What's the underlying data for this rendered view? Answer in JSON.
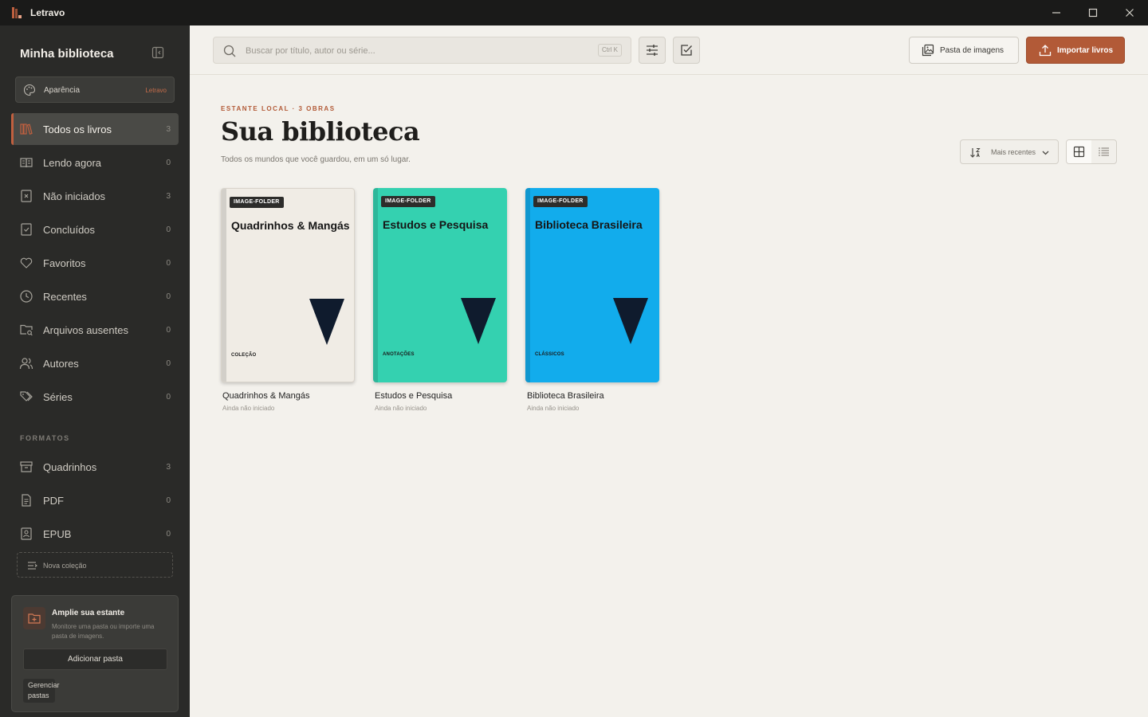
{
  "window": {
    "app_name": "Letravo"
  },
  "sidebar": {
    "title": "Minha biblioteca",
    "appearance": {
      "label": "Aparência",
      "theme": "Letravo"
    },
    "items": [
      {
        "label": "Todos os livros",
        "count": "3",
        "icon": "books-icon",
        "active": true
      },
      {
        "label": "Lendo agora",
        "count": "0",
        "icon": "book-open-icon"
      },
      {
        "label": "Não iniciados",
        "count": "3",
        "icon": "book-x-icon"
      },
      {
        "label": "Concluídos",
        "count": "0",
        "icon": "book-check-icon"
      },
      {
        "label": "Favoritos",
        "count": "0",
        "icon": "heart-icon"
      },
      {
        "label": "Recentes",
        "count": "0",
        "icon": "clock-icon"
      },
      {
        "label": "Arquivos ausentes",
        "count": "0",
        "icon": "folder-search-icon"
      },
      {
        "label": "Autores",
        "count": "0",
        "icon": "users-icon"
      },
      {
        "label": "Séries",
        "count": "0",
        "icon": "tags-icon"
      }
    ],
    "formats_heading": "FORMATOS",
    "formats": [
      {
        "label": "Quadrinhos",
        "count": "3",
        "icon": "archive-icon"
      },
      {
        "label": "PDF",
        "count": "0",
        "icon": "file-text-icon"
      },
      {
        "label": "EPUB",
        "count": "0",
        "icon": "book-image-icon"
      }
    ],
    "new_collection": "Nova coleção",
    "promo": {
      "title": "Amplie sua estante",
      "description": "Monitore uma pasta ou importe uma pasta de imagens.",
      "add_folder": "Adicionar pasta",
      "manage_folders": "Gerenciar pastas"
    }
  },
  "toolbar": {
    "search_placeholder": "Buscar por título, autor ou série...",
    "search_shortcut": "Ctrl K",
    "image_folder_label": "Pasta de imagens",
    "import_label": "Importar livros"
  },
  "main": {
    "eyebrow": "ESTANTE LOCAL · 3 OBRAS",
    "title": "Sua biblioteca",
    "subtitle": "Todos os mundos que você guardou, em um só lugar.",
    "sort_label": "Mais recentes"
  },
  "books": [
    {
      "badge": "IMAGE-FOLDER",
      "cover_title": "Quadrinhos & Mangás",
      "cover_tag": "COLEÇÃO",
      "title": "Quadrinhos & Mangás",
      "status": "Ainda não iniciado",
      "color": "#f0ece5"
    },
    {
      "badge": "IMAGE-FOLDER",
      "cover_title": "Estudos e Pesquisa",
      "cover_tag": "ANOTAÇÕES",
      "title": "Estudos e Pesquisa",
      "status": "Ainda não iniciado",
      "color": "#34d1b0"
    },
    {
      "badge": "IMAGE-FOLDER",
      "cover_title": "Biblioteca Brasileira",
      "cover_tag": "CLÁSSICOS",
      "title": "Biblioteca Brasileira",
      "status": "Ainda não iniciado",
      "color": "#12acec"
    }
  ],
  "colors": {
    "accent": "#b25a37",
    "sidebar_bg": "#2a2a28",
    "content_bg": "#f3f1ec",
    "titlebar_bg": "#1a1a19",
    "cover_triangle": "#0f1b2d"
  }
}
